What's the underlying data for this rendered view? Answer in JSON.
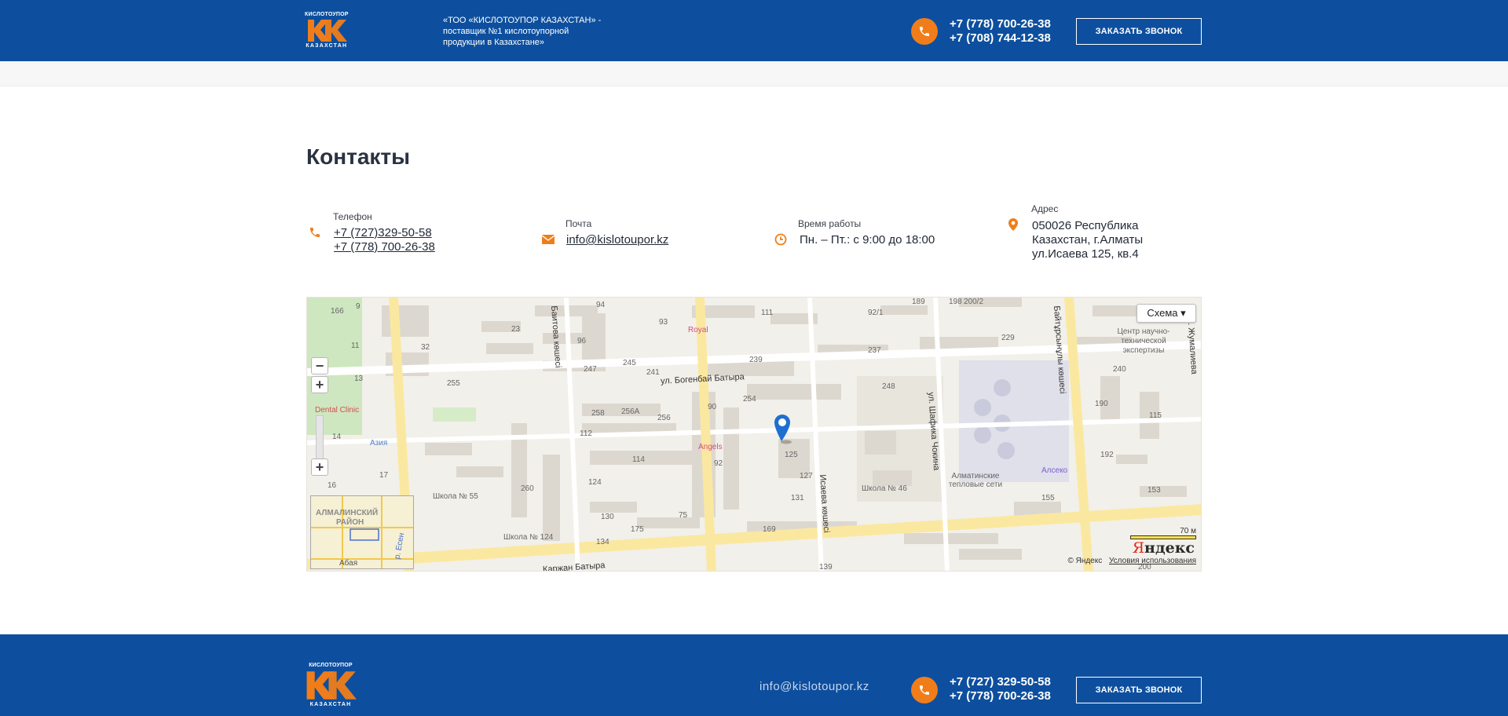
{
  "header": {
    "logo": {
      "top_text": "КИСЛОТОУПОР",
      "bottom_text": "КАЗАХСТАН"
    },
    "tagline": "«ТОО «КИСЛОТОУПОР КАЗАХСТАН» - поставщик №1 кислотоупорной продукции в Казахстане»",
    "phones": [
      "+7 (778) 700-26-38",
      "+7 (708) 744-12-38"
    ],
    "callback_label": "ЗАКАЗАТЬ ЗВОНОК"
  },
  "contacts": {
    "title": "Контакты",
    "phone": {
      "label": "Телефон",
      "values": [
        "+7 (727)329-50-58",
        "+7 (778) 700-26-38"
      ]
    },
    "email": {
      "label": "Почта",
      "value": "info@kislotoupor.kz"
    },
    "hours": {
      "label": "Время работы",
      "value": "Пн. – Пт.: с 9:00 до 18:00"
    },
    "address": {
      "label": "Адрес",
      "lines": [
        "050026 Республика",
        "Казахстан, г.Алматы",
        "ул.Исаева 125, кв.4"
      ]
    }
  },
  "map": {
    "type_button": "Схема ▾",
    "zoom_in": "+",
    "zoom_out": "−",
    "scale_label": "70 м",
    "copyright": "© Яндекс",
    "terms_link": "Условия использования",
    "yandex_logo": {
      "first": "Я",
      "rest": "ндекс"
    },
    "minimap_labels": [
      "АЛМАЛИНСКИЙ",
      "РАЙОН",
      "Абая",
      "р. Есен"
    ],
    "streets": [
      "ул. Богенбай Батыра",
      "ул. Шафика Чокина",
      "Исаева көшесі",
      "ул. Жумалиева",
      "Байтұрсынұлы көшесі",
      "Қаржан Батыра",
      "Баитова көшесі"
    ],
    "places": [
      {
        "name": "Royal"
      },
      {
        "name": "Angels"
      },
      {
        "name": "Dental Clinic"
      },
      {
        "name": "Азия"
      },
      {
        "name": "Школа № 55"
      },
      {
        "name": "Школа № 124"
      },
      {
        "name": "Школа № 46"
      },
      {
        "name": "Алматинские тепловые сети"
      },
      {
        "name": "Алсеко"
      },
      {
        "name": "Центр научно-технической экспертизы"
      }
    ],
    "building_numbers": [
      "166",
      "9",
      "11",
      "13",
      "14",
      "16",
      "17",
      "32",
      "23",
      "94",
      "93",
      "96",
      "247",
      "245",
      "241",
      "255",
      "111",
      "239",
      "92/1",
      "237",
      "189",
      "198",
      "200/2",
      "229",
      "240",
      "254",
      "90",
      "248",
      "258",
      "256А",
      "256",
      "112",
      "114",
      "92",
      "125",
      "127",
      "131",
      "190",
      "115",
      "192",
      "155",
      "153",
      "260",
      "124",
      "130",
      "175",
      "75",
      "169",
      "134",
      "139",
      "200"
    ]
  },
  "footer": {
    "logo": {
      "top_text": "КИСЛОТОУПОР",
      "bottom_text": "КАЗАХСТАН"
    },
    "email": "info@kislotoupor.kz",
    "phones": [
      "+7 (727) 329-50-58",
      "+7 (778) 700-26-38"
    ],
    "callback_label": "ЗАКАЗАТЬ ЗВОНОК"
  },
  "colors": {
    "brand_blue": "#0d4f9e",
    "accent_orange": "#f07d1a"
  }
}
